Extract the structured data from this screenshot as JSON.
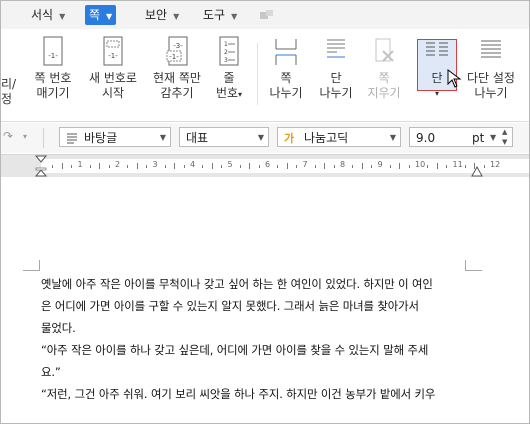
{
  "menu": {
    "items": [
      {
        "label": "서식",
        "active": false
      },
      {
        "label": "쪽",
        "active": true
      },
      {
        "label": "보안",
        "active": false
      },
      {
        "label": "도구",
        "active": false
      }
    ]
  },
  "ribbon": {
    "partial_label_top": "리/",
    "partial_label_bottom": "정",
    "buttons": [
      {
        "name": "page-number-hide",
        "line1": "쪽 번호",
        "line2": "매기기"
      },
      {
        "name": "new-number-start",
        "line1": "새 번호로",
        "line2": "시작"
      },
      {
        "name": "hide-current-page",
        "line1": "현재 쪽만",
        "line2": "감추기"
      },
      {
        "name": "line-number",
        "line1": "줄",
        "line2": "번호"
      },
      {
        "name": "page-break",
        "line1": "쪽",
        "line2": "나누기"
      },
      {
        "name": "column-break",
        "line1": "단",
        "line2": "나누기"
      },
      {
        "name": "page-erase",
        "line1": "쪽",
        "line2": "지우기"
      },
      {
        "name": "columns",
        "line1": "단",
        "line2": ""
      },
      {
        "name": "multi-column-break",
        "line1": "다단 설정",
        "line2": "나누기"
      }
    ]
  },
  "format_toolbar": {
    "style": "바탕글",
    "category": "대표",
    "font": "나눔고딕",
    "size": "9.0",
    "unit": "pt"
  },
  "ruler": {
    "numbers": [
      "1",
      "2",
      "3",
      "4",
      "5",
      "6",
      "7",
      "8",
      "9",
      "10",
      "11",
      "12"
    ]
  },
  "document": {
    "lines": [
      "옛날에 아주 작은 아이를 무척이나 갖고 싶어 하는 한 여인이 있었다. 하지만 이 여인",
      "은 어디에 가면 아이를 구할 수 있는지 알지 못했다. 그래서 늙은 마녀를 찾아가서",
      "물었다.",
      "“아주 작은 아이를 하나 갖고 싶은데, 어디에 가면 아이를 찾을 수 있는지 말해 주세",
      "요.”",
      "“저런, 그건 아주 쉬워. 여기 보리 씨앗을 하나 주지. 하지만 이건 농부가 밭에서 키우"
    ]
  }
}
